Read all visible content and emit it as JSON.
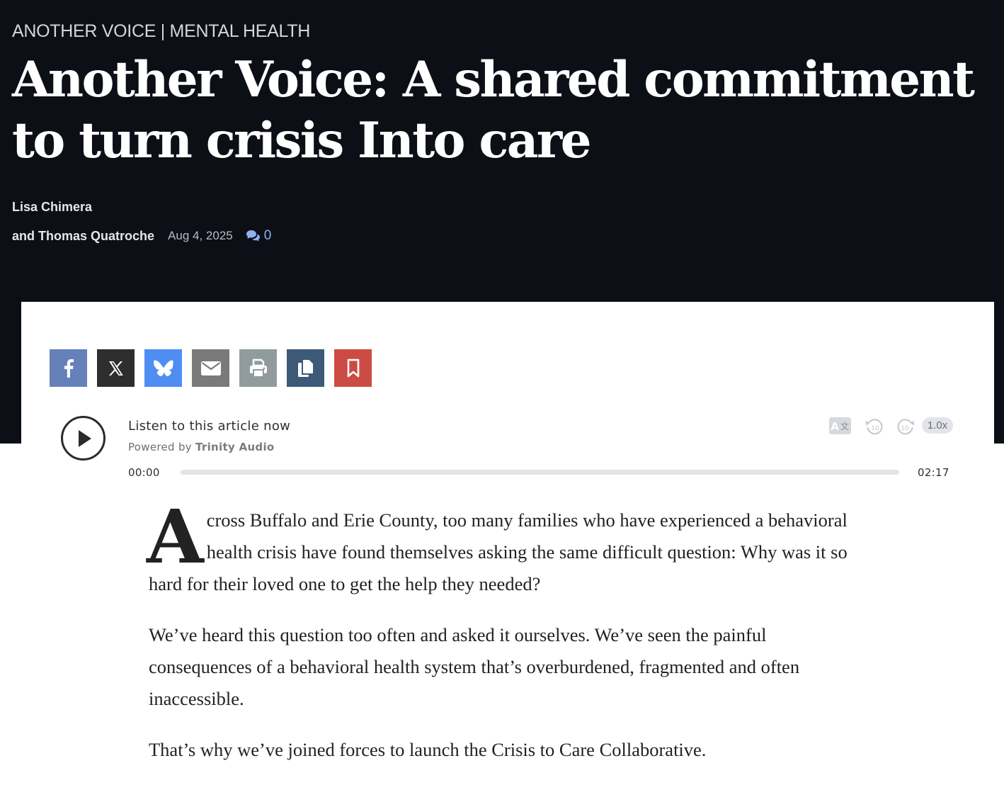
{
  "header": {
    "kicker": "ANOTHER VOICE | MENTAL HEALTH",
    "headline": "Another Voice: A shared commitment to turn crisis Into care",
    "byline_line1": "Lisa Chimera",
    "byline_line2": "and Thomas Quatroche",
    "date": "Aug 4, 2025",
    "comment_count": "0"
  },
  "share": {
    "buttons": [
      {
        "name": "facebook",
        "icon": "facebook-icon",
        "color": "#6680b9"
      },
      {
        "name": "x",
        "icon": "x-icon",
        "color": "#2e2e2e"
      },
      {
        "name": "bluesky",
        "icon": "bluesky-icon",
        "color": "#4e8ef2"
      },
      {
        "name": "email",
        "icon": "envelope-icon",
        "color": "#7a7a7a"
      },
      {
        "name": "print",
        "icon": "printer-icon",
        "color": "#919b9e"
      },
      {
        "name": "copy",
        "icon": "copy-icon",
        "color": "#3c5a78"
      },
      {
        "name": "bookmark",
        "icon": "bookmark-icon",
        "color": "#cd4b45"
      }
    ]
  },
  "audio_player": {
    "title": "Listen to this article now",
    "powered_prefix": "Powered by",
    "powered_brand": "Trinity Audio",
    "time_current": "00:00",
    "time_total": "02:17",
    "progress": 0,
    "speed": "1.0x",
    "rewind_label": "10",
    "forward_label": "10"
  },
  "article": {
    "drop_cap": "A",
    "paragraph_1": "cross Buffalo and Erie County, too many families who have experienced a behavioral health crisis have found themselves asking the same difficult question: Why was it so hard for their loved one to get the help they needed?",
    "paragraph_2": "We’ve heard this question too often and asked it ourselves. We’ve seen the painful consequences of a behavioral health system that’s overburdened, fragmented and often inaccessible.",
    "paragraph_3": "That’s why we’ve joined forces to launch the Crisis to Care Collaborative."
  }
}
